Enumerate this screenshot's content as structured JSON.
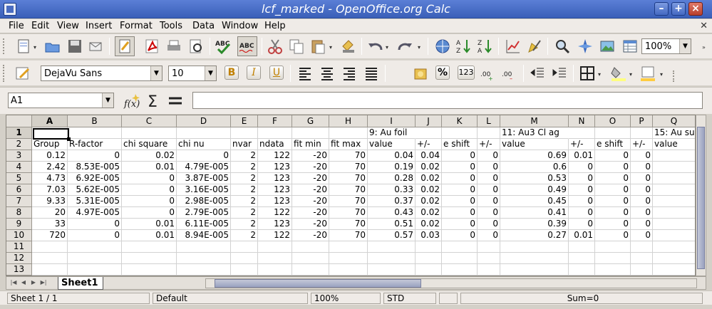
{
  "window": {
    "title": "lcf_marked - OpenOffice.org Calc"
  },
  "menu": [
    "File",
    "Edit",
    "View",
    "Insert",
    "Format",
    "Tools",
    "Data",
    "Window",
    "Help"
  ],
  "toolbar": {
    "zoom": "100%"
  },
  "format_toolbar": {
    "font_name": "DejaVu Sans",
    "font_size": "10",
    "bold": "B",
    "italic": "I",
    "underline": "U",
    "percent": "%",
    "number": "123"
  },
  "formula": {
    "cell_ref": "A1",
    "content": ""
  },
  "columns": [
    "A",
    "B",
    "C",
    "D",
    "E",
    "F",
    "G",
    "H",
    "I",
    "J",
    "K",
    "L",
    "M",
    "N",
    "O",
    "P",
    "Q"
  ],
  "rows": [
    [
      "",
      "",
      "",
      "",
      "",
      "",
      "",
      "",
      "9: Au foil",
      "",
      "",
      "",
      "11: Au3 Cl ag",
      "",
      "",
      "",
      "15: Au su"
    ],
    [
      "Group",
      "R-factor",
      "chi square",
      "chi nu",
      "nvar",
      "ndata",
      "fit min",
      "fit max",
      "value",
      "+/-",
      "e shift",
      "+/-",
      "value",
      "+/-",
      "e shift",
      "+/-",
      "value"
    ],
    [
      "0.12",
      "0",
      "0.02",
      "0",
      "2",
      "122",
      "-20",
      "70",
      "0.04",
      "0.04",
      "0",
      "0",
      "0.69",
      "0.01",
      "0",
      "0",
      ""
    ],
    [
      "2.42",
      "8.53E-005",
      "0.01",
      "4.79E-005",
      "2",
      "123",
      "-20",
      "70",
      "0.19",
      "0.02",
      "0",
      "0",
      "0.6",
      "0",
      "0",
      "0",
      ""
    ],
    [
      "4.73",
      "6.92E-005",
      "0",
      "3.87E-005",
      "2",
      "123",
      "-20",
      "70",
      "0.28",
      "0.02",
      "0",
      "0",
      "0.53",
      "0",
      "0",
      "0",
      ""
    ],
    [
      "7.03",
      "5.62E-005",
      "0",
      "3.16E-005",
      "2",
      "123",
      "-20",
      "70",
      "0.33",
      "0.02",
      "0",
      "0",
      "0.49",
      "0",
      "0",
      "0",
      ""
    ],
    [
      "9.33",
      "5.31E-005",
      "0",
      "2.98E-005",
      "2",
      "123",
      "-20",
      "70",
      "0.37",
      "0.02",
      "0",
      "0",
      "0.45",
      "0",
      "0",
      "0",
      ""
    ],
    [
      "20",
      "4.97E-005",
      "0",
      "2.79E-005",
      "2",
      "122",
      "-20",
      "70",
      "0.43",
      "0.02",
      "0",
      "0",
      "0.41",
      "0",
      "0",
      "0",
      ""
    ],
    [
      "33",
      "0",
      "0.01",
      "6.11E-005",
      "2",
      "123",
      "-20",
      "70",
      "0.51",
      "0.02",
      "0",
      "0",
      "0.39",
      "0",
      "0",
      "0",
      ""
    ],
    [
      "720",
      "0",
      "0.01",
      "8.94E-005",
      "2",
      "122",
      "-20",
      "70",
      "0.57",
      "0.03",
      "0",
      "0",
      "0.27",
      "0.01",
      "0",
      "0",
      ""
    ],
    [
      "",
      "",
      "",
      "",
      "",
      "",
      "",
      "",
      "",
      "",
      "",
      "",
      "",
      "",
      "",
      "",
      ""
    ],
    [
      "",
      "",
      "",
      "",
      "",
      "",
      "",
      "",
      "",
      "",
      "",
      "",
      "",
      "",
      "",
      "",
      ""
    ],
    [
      "",
      "",
      "",
      "",
      "",
      "",
      "",
      "",
      "",
      "",
      "",
      "",
      "",
      "",
      "",
      "",
      ""
    ]
  ],
  "sheet_tab": "Sheet1",
  "status": {
    "sheet": "Sheet 1 / 1",
    "style": "Default",
    "zoom": "100%",
    "mode": "STD",
    "sum": "Sum=0"
  }
}
